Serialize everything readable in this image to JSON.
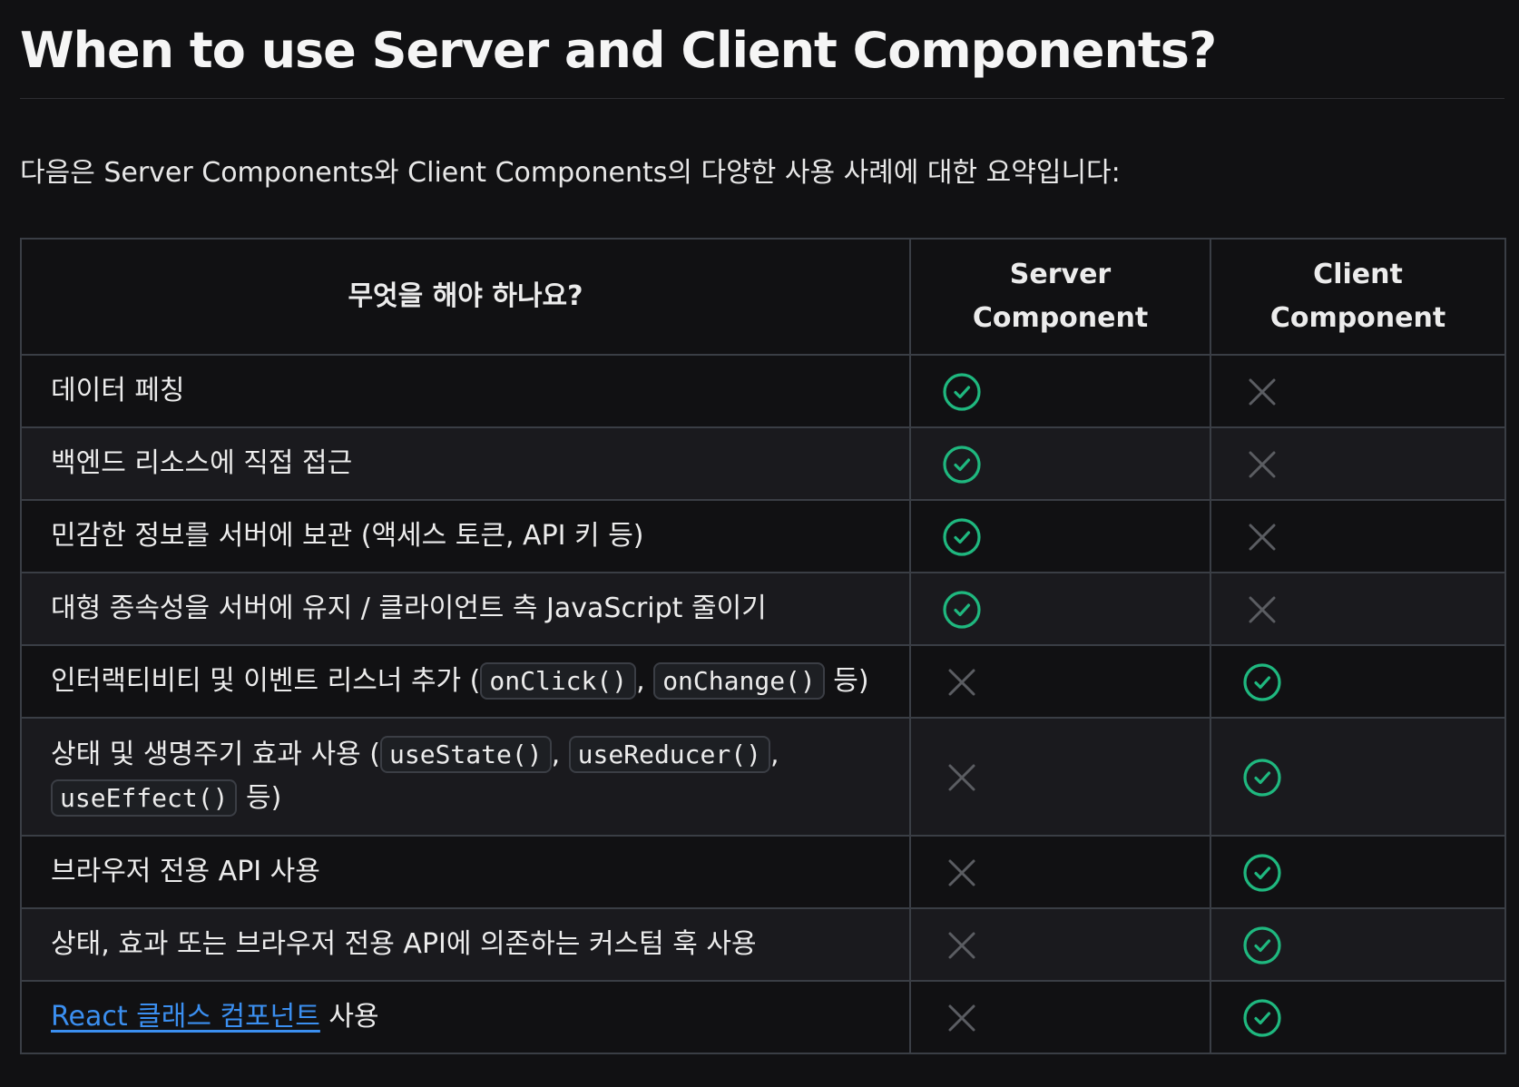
{
  "page": {
    "title": "When to use Server and Client Components?",
    "intro": "다음은 Server Components와 Client Components의 다양한 사용 사례에 대한 요약입니다:"
  },
  "table": {
    "headers": {
      "task": "무엇을 해야 하나요?",
      "server": "Server Component",
      "client": "Client Component"
    },
    "rows": [
      {
        "task": "데이터 페칭",
        "server": true,
        "client": false
      },
      {
        "task": "백엔드 리소스에 직접 접근",
        "server": true,
        "client": false
      },
      {
        "task": "민감한 정보를 서버에 보관 (액세스 토큰, API 키 등)",
        "server": true,
        "client": false
      },
      {
        "task": "대형 종속성을 서버에 유지 / 클라이언트 측 JavaScript 줄이기",
        "server": true,
        "client": false
      },
      {
        "task_prefix": "인터랙티비티 및 이벤트 리스너 추가 (",
        "code1": "onClick()",
        "sep1": ", ",
        "code2": "onChange()",
        "suffix": " 등)",
        "server": false,
        "client": true
      },
      {
        "task_prefix": "상태 및 생명주기 효과 사용 (",
        "code1": "useState()",
        "sep1": ", ",
        "code2": "useReducer()",
        "sep2": ",",
        "code3": "useEffect()",
        "suffix": " 등)",
        "server": false,
        "client": true
      },
      {
        "task": "브라우저 전용 API 사용",
        "server": false,
        "client": true
      },
      {
        "task": "상태, 효과 또는 브라우저 전용 API에 의존하는 커스텀 훅 사용",
        "server": false,
        "client": true
      },
      {
        "link": "React 클래스 컴포넌트",
        "task_suffix": " 사용",
        "server": false,
        "client": true
      }
    ]
  },
  "icons": {
    "check": "check-circle-icon",
    "cross": "x-icon"
  },
  "colors": {
    "check": "#1fb87f",
    "cross": "#5b5d62",
    "link": "#3b8ff0"
  }
}
